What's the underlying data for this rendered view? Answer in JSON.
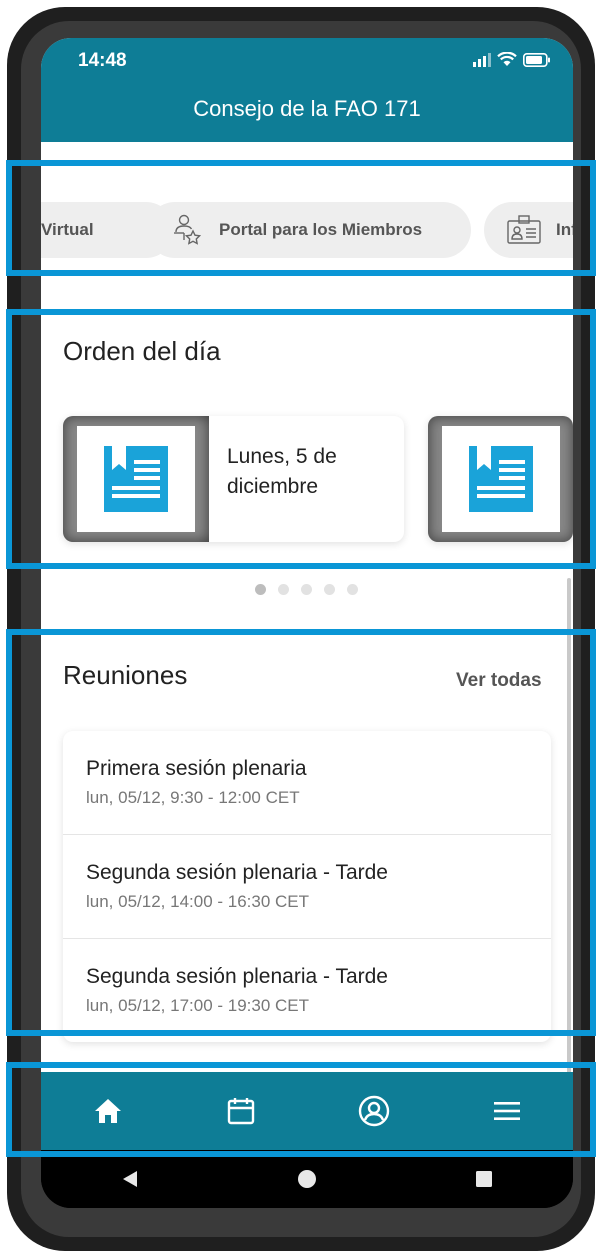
{
  "status_bar": {
    "time": "14:48"
  },
  "header": {
    "title": "Consejo de la FAO 171"
  },
  "quick_links": [
    {
      "label": "Virtual",
      "icon": "virtual-icon"
    },
    {
      "label": "Portal para los Miembros",
      "icon": "member-portal-icon"
    },
    {
      "label": "Info",
      "icon": "id-card-icon"
    }
  ],
  "agenda": {
    "title": "Orden del día",
    "cards": [
      {
        "label": "Lunes, 5 de diciembre",
        "icon": "document-icon"
      },
      {
        "label": "",
        "icon": "document-icon"
      }
    ],
    "page_count": 5,
    "active_page": 0
  },
  "meetings": {
    "title": "Reuniones",
    "see_all": "Ver todas",
    "items": [
      {
        "title": "Primera sesión plenaria",
        "time": "lun, 05/12, 9:30 - 12:00 CET"
      },
      {
        "title": "Segunda sesión plenaria - Tarde",
        "time": "lun, 05/12, 14:00 - 16:30 CET"
      },
      {
        "title": "Segunda sesión plenaria - Tarde",
        "time": "lun, 05/12, 17:00 - 19:30 CET"
      }
    ]
  },
  "bottom_nav": [
    {
      "icon": "home-icon",
      "active": true
    },
    {
      "icon": "calendar-icon",
      "active": false
    },
    {
      "icon": "profile-icon",
      "active": false
    },
    {
      "icon": "menu-icon",
      "active": false
    }
  ],
  "colors": {
    "primary": "#0e7d96",
    "highlight": "#0a96d6",
    "doc_icon": "#1aa3d9"
  }
}
